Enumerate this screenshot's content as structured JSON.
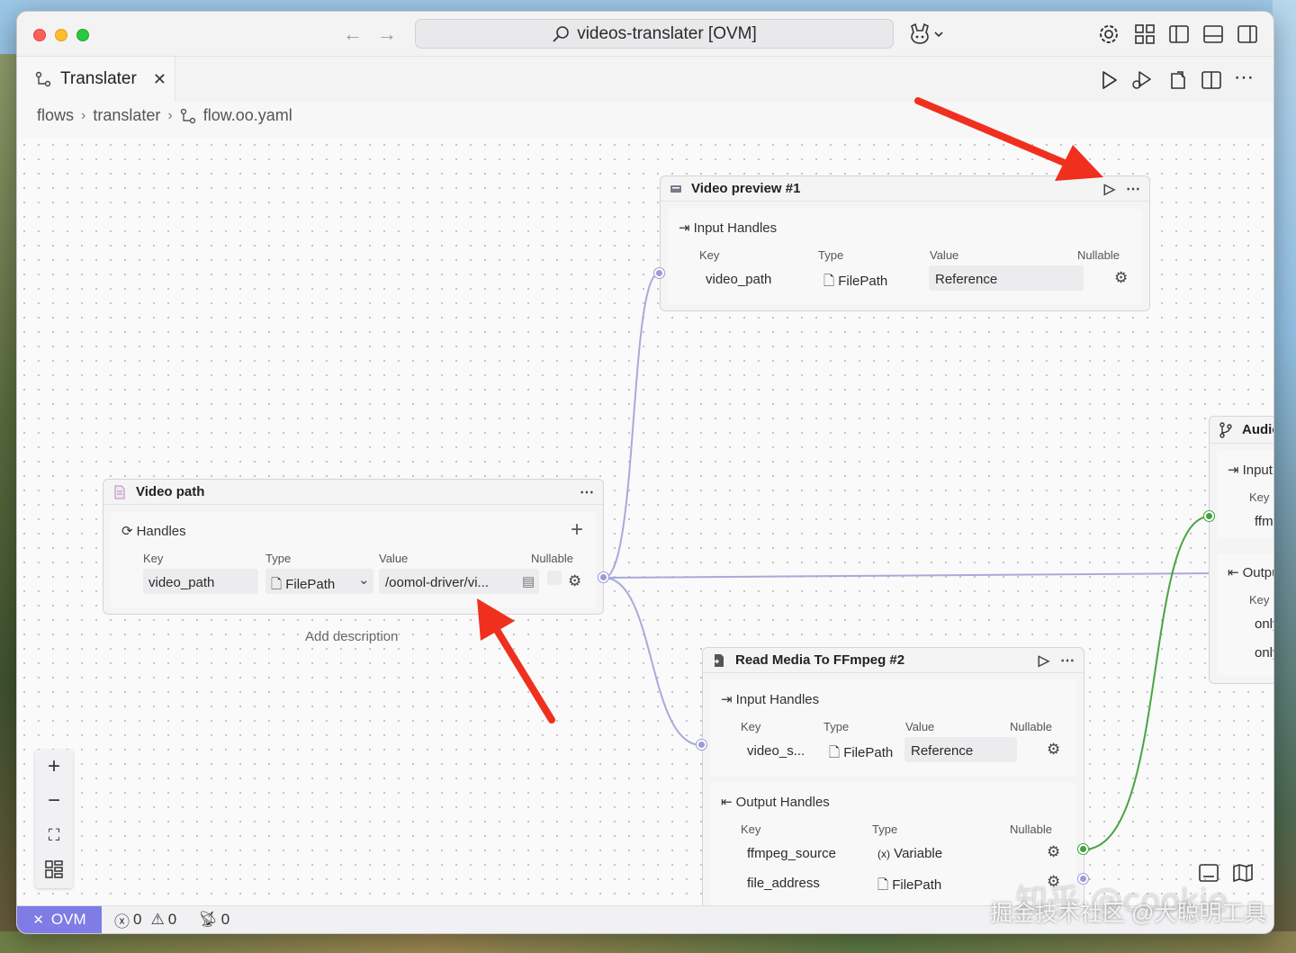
{
  "window": {
    "search_title": "videos-translater [OVM]"
  },
  "tab": {
    "label": "Translater"
  },
  "breadcrumb": [
    "flows",
    "translater",
    "flow.oo.yaml"
  ],
  "nodes": {
    "video_preview": {
      "title": "Video preview #1",
      "section_title": "Input Handles",
      "columns": [
        "Key",
        "Type",
        "Value",
        "Nullable"
      ],
      "row": {
        "key": "video_path",
        "type": "FilePath",
        "value": "Reference"
      }
    },
    "video_path": {
      "title": "Video path",
      "section_title": "Handles",
      "columns": [
        "Key",
        "Type",
        "Value",
        "Nullable"
      ],
      "row": {
        "key": "video_path",
        "type": "FilePath",
        "value": "/oomol-driver/vi..."
      },
      "description_placeholder": "Add description"
    },
    "read_media": {
      "title": "Read Media To FFmpeg #2",
      "input_title": "Input Handles",
      "input_columns": [
        "Key",
        "Type",
        "Value",
        "Nullable"
      ],
      "input_row": {
        "key": "video_s...",
        "type": "FilePath",
        "value": "Reference"
      },
      "output_title": "Output Handles",
      "output_columns": [
        "Key",
        "Type",
        "Nullable"
      ],
      "output_rows": [
        {
          "key": "ffmpeg_source",
          "type": "Variable"
        },
        {
          "key": "file_address",
          "type": "FilePath"
        }
      ]
    },
    "audio_partial": {
      "title": "Audic",
      "input_title": "Input",
      "input_col": "Key",
      "input_val": "ffm",
      "output_title": "Outpu",
      "output_col": "Key",
      "output_vals": [
        "only",
        "only"
      ]
    }
  },
  "statusbar": {
    "remote": "OVM",
    "errors": "0",
    "warnings": "0",
    "ports": "0"
  },
  "watermark": {
    "line1": "知乎 @cookie",
    "line2": "掘金技术社区 @大聪明工具"
  },
  "colors": {
    "edge_purple": "#9b9cd6",
    "edge_green": "#3fa33b",
    "arrow_red": "#f0301f",
    "remote_bg": "#7f7ce6"
  }
}
